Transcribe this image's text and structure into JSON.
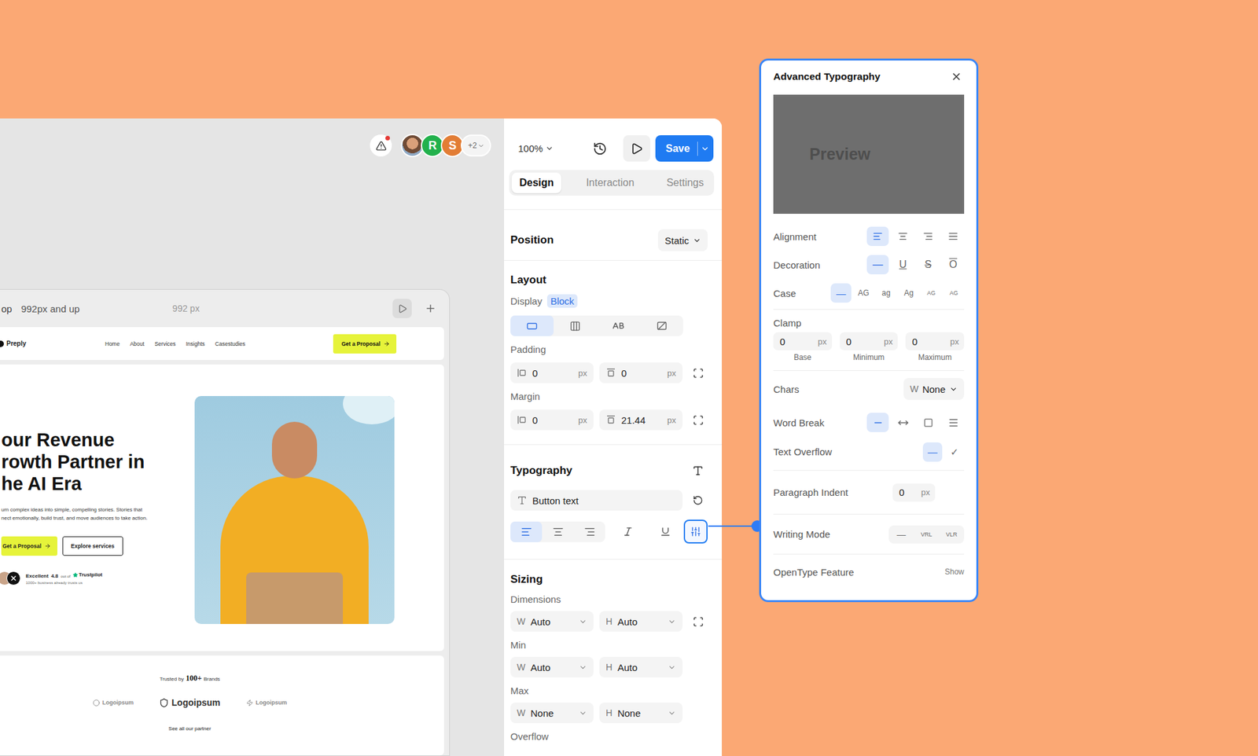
{
  "editor": {
    "zoom": "100%",
    "save": "Save",
    "alert_badge": true,
    "collaborators": [
      {
        "initial": "R",
        "color": "#22b14c"
      },
      {
        "initial": "S",
        "color": "#e27d35"
      }
    ],
    "more_collaborators": "+2"
  },
  "tabs": [
    {
      "label": "Design",
      "selected": true
    },
    {
      "label": "Interaction",
      "selected": false
    },
    {
      "label": "Settings",
      "selected": false
    }
  ],
  "position": {
    "title": "Position",
    "value": "Static"
  },
  "layout": {
    "title": "Layout",
    "display_label": "Display",
    "display_value": "Block",
    "display_options": [
      {
        "selected": true
      },
      {
        "selected": false
      },
      {
        "selected": false
      },
      {
        "selected": false
      }
    ],
    "padding_label": "Padding",
    "padding": [
      {
        "value": "0",
        "unit": "px"
      },
      {
        "value": "0",
        "unit": "px"
      }
    ],
    "margin_label": "Margin",
    "margin": [
      {
        "value": "0",
        "unit": "px"
      },
      {
        "value": "21.44",
        "unit": "px"
      }
    ]
  },
  "typography": {
    "title": "Typography",
    "style": "Button text",
    "align_options": [
      {
        "selected": true
      },
      {
        "selected": false
      },
      {
        "selected": false
      }
    ],
    "italic": false,
    "underline": false,
    "advanced_open": true
  },
  "sizing": {
    "title": "Sizing",
    "groups": [
      {
        "label": "Dimensions",
        "fields": [
          {
            "axis": "W",
            "value": "Auto"
          },
          {
            "axis": "H",
            "value": "Auto"
          }
        ]
      },
      {
        "label": "Min",
        "fields": [
          {
            "axis": "W",
            "value": "Auto"
          },
          {
            "axis": "H",
            "value": "Auto"
          }
        ]
      },
      {
        "label": "Max",
        "fields": [
          {
            "axis": "W",
            "value": "None"
          },
          {
            "axis": "H",
            "value": "None"
          }
        ]
      }
    ],
    "overflow_label": "Overflow"
  },
  "canvas": {
    "breakpoint_name": "op",
    "breakpoint": "992px and up",
    "width": "992 px"
  },
  "site": {
    "logo": "Preply",
    "nav": [
      "Home",
      "About",
      "Services",
      "Insights",
      "Casestudies"
    ],
    "cta": "Get a Proposal",
    "headline": [
      "our Revenue",
      "rowth Partner in",
      "he AI Era"
    ],
    "body": [
      "urn complex ideas into simple, compelling stories. Stories that",
      "nect emotionally, build trust, and move audiences to take action."
    ],
    "primary_button": "Get a Proposal",
    "secondary_button": "Explore services",
    "rating": {
      "label": "Excellent",
      "score": "4.8",
      "out_of": "out of",
      "platform": "Trustpilot",
      "note": "1000+ business already trusts us"
    },
    "trusted": {
      "prefix": "Trusted by",
      "count": "100+",
      "suffix": "Brands"
    },
    "logos": [
      {
        "name": "Logoipsum",
        "kind": "small"
      },
      {
        "name": "Logoipsum",
        "kind": "large"
      },
      {
        "name": "Logoipsum",
        "kind": "small"
      }
    ],
    "partners_link": "See all our partner"
  },
  "advanced_typography": {
    "title": "Advanced Typography",
    "preview": "Preview",
    "alignment": {
      "label": "Alignment",
      "options": [
        {
          "selected": true
        },
        {
          "selected": false
        },
        {
          "selected": false
        },
        {
          "selected": false
        }
      ]
    },
    "decoration": {
      "label": "Decoration",
      "options": [
        {
          "label": "—",
          "kind": "none",
          "selected": true
        },
        {
          "label": "U",
          "kind": "underline",
          "selected": false
        },
        {
          "label": "S",
          "kind": "strike",
          "selected": false
        },
        {
          "label": "O",
          "kind": "overline",
          "selected": false
        }
      ]
    },
    "case": {
      "label": "Case",
      "options": [
        {
          "label": "—",
          "kind": "dash",
          "selected": true
        },
        {
          "label": "AG",
          "kind": "text",
          "selected": false
        },
        {
          "label": "ag",
          "kind": "text",
          "selected": false
        },
        {
          "label": "Ag",
          "kind": "text",
          "selected": false
        },
        {
          "label": "AG",
          "kind": "small",
          "selected": false
        },
        {
          "label": "AG",
          "kind": "small",
          "selected": false
        }
      ]
    },
    "clamp": {
      "label": "Clamp",
      "fields": [
        {
          "value": "0",
          "unit": "px",
          "caption": "Base"
        },
        {
          "value": "0",
          "unit": "px",
          "caption": "Minimum"
        },
        {
          "value": "0",
          "unit": "px",
          "caption": "Maximum"
        }
      ]
    },
    "chars": {
      "label": "Chars",
      "prefix": "W",
      "value": "None"
    },
    "word_break": {
      "label": "Word Break",
      "options": [
        {
          "selected": true
        },
        {
          "selected": false
        },
        {
          "selected": false
        },
        {
          "selected": false
        }
      ]
    },
    "text_overflow": {
      "label": "Text Overflow",
      "options": [
        {
          "label": "—",
          "selected": true
        },
        {
          "label": "✓",
          "selected": false
        }
      ]
    },
    "paragraph_indent": {
      "label": "Paragraph Indent",
      "value": "0",
      "unit": "px"
    },
    "writing_mode": {
      "label": "Writing Mode",
      "options": [
        {
          "label": "—",
          "selected": false
        },
        {
          "label": "VRL",
          "selected": false
        },
        {
          "label": "VLR",
          "selected": false
        }
      ]
    },
    "opentype": {
      "label": "OpenType Feature",
      "action": "Show"
    }
  }
}
